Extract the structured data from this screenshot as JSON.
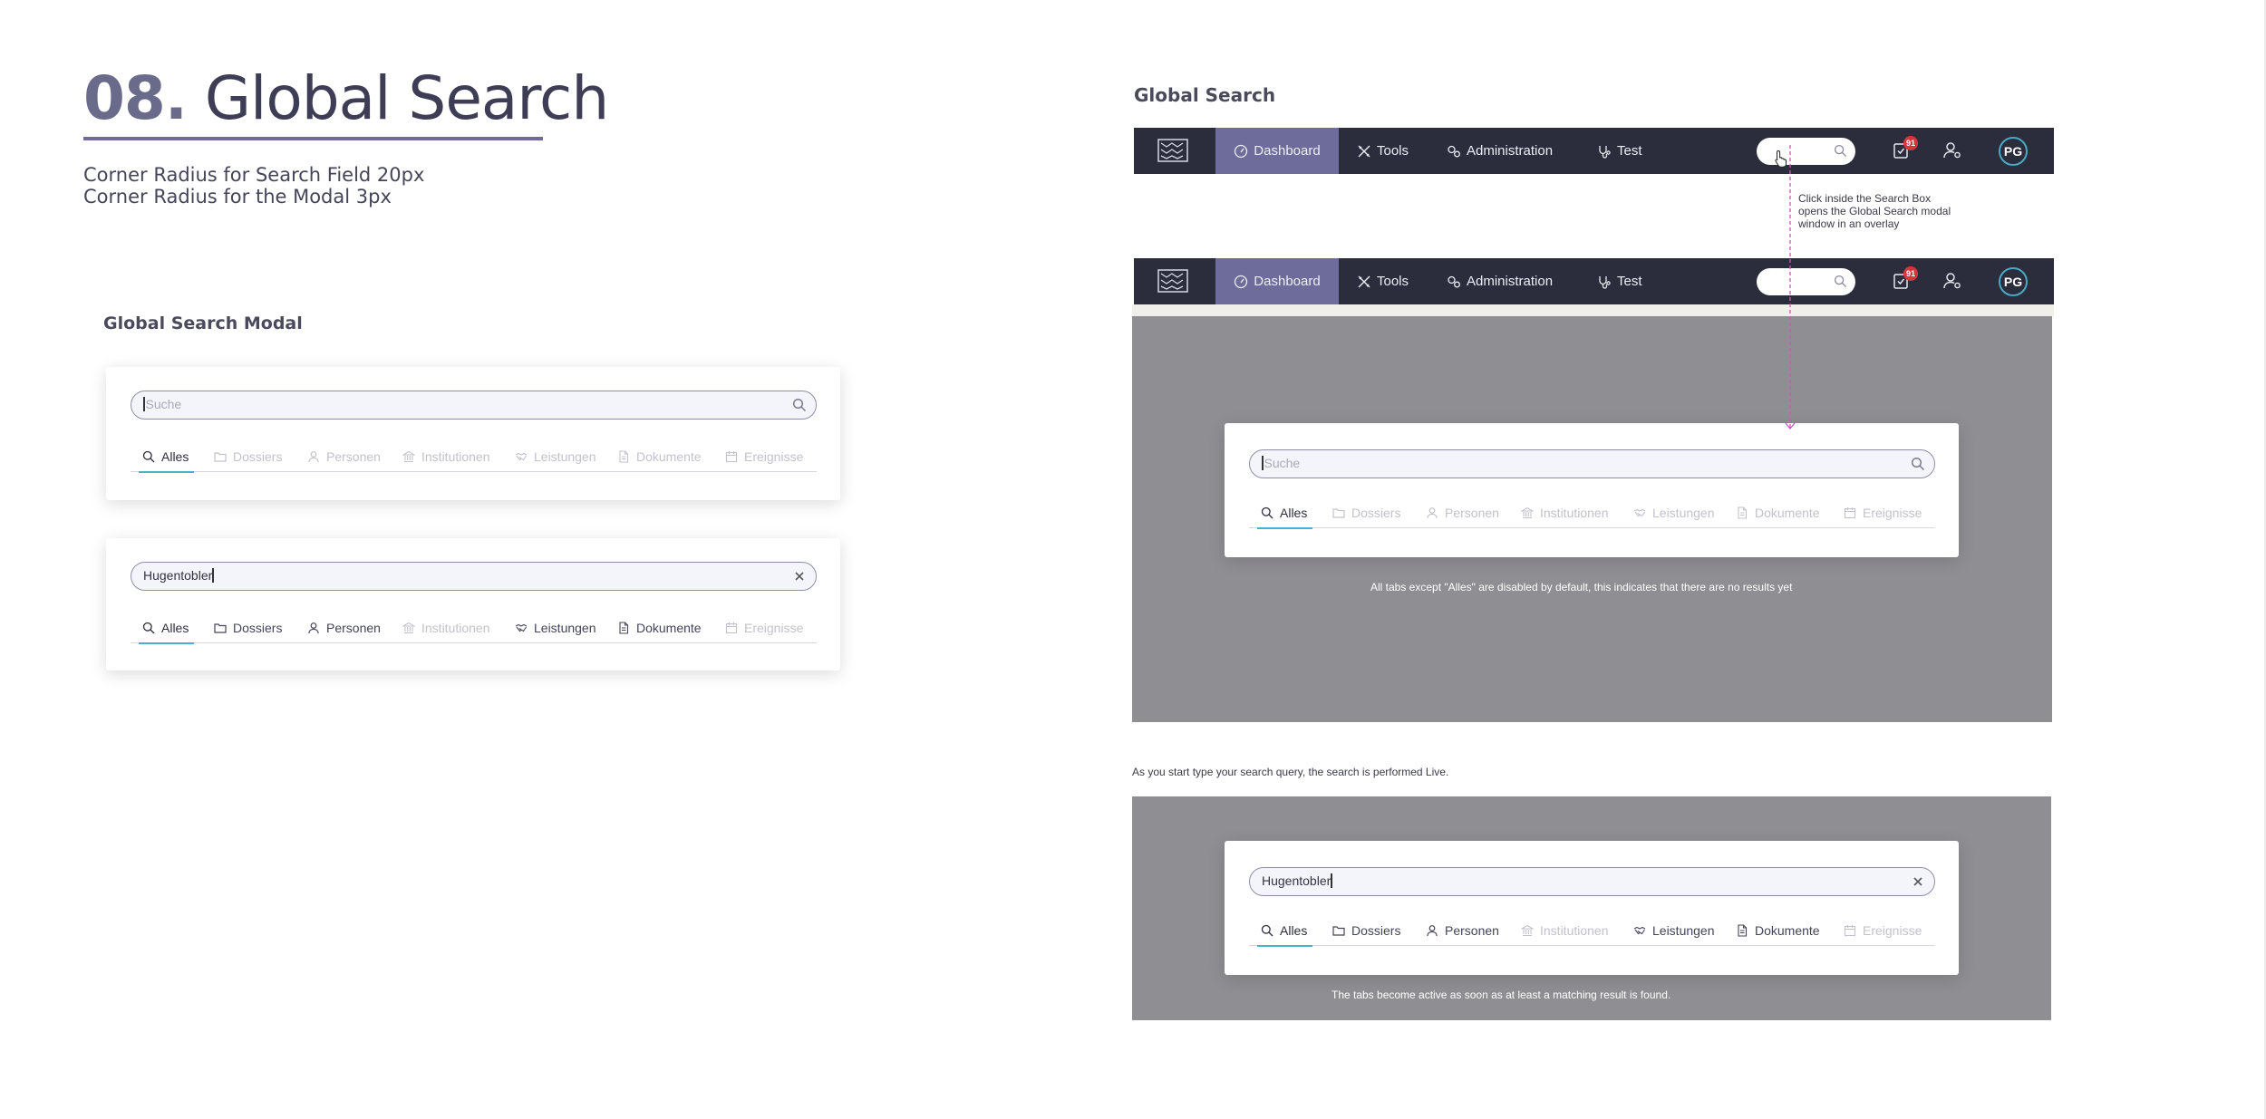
{
  "heading": {
    "number": "08.",
    "title": "Global Search"
  },
  "notes": [
    "Corner Radius for Search Field 20px",
    "Corner Radius for the Modal 3px"
  ],
  "left_section_label": "Global Search Modal",
  "right_section_label": "Global Search",
  "tabs": [
    {
      "label": "Alles",
      "icon": "search-icon"
    },
    {
      "label": "Dossiers",
      "icon": "folder-icon"
    },
    {
      "label": "Personen",
      "icon": "person-icon"
    },
    {
      "label": "Institutionen",
      "icon": "institution-icon"
    },
    {
      "label": "Leistungen",
      "icon": "handshake-icon"
    },
    {
      "label": "Dokumente",
      "icon": "document-icon"
    },
    {
      "label": "Ereignisse",
      "icon": "calendar-icon"
    }
  ],
  "empty_search": {
    "placeholder": "Suche",
    "enabled_tabs": [
      "Alles"
    ]
  },
  "filled_search": {
    "value": "Hugentobler",
    "enabled_tabs": [
      "Alles",
      "Dossiers",
      "Personen",
      "Leistungen",
      "Dokumente"
    ],
    "disabled_tabs": [
      "Institutionen",
      "Ereignisse"
    ]
  },
  "navbar": {
    "items": [
      "Dashboard",
      "Tools",
      "Administration",
      "Test"
    ],
    "active": "Dashboard",
    "notification_count": "91",
    "avatar_initials": "PG"
  },
  "annotations": {
    "click_hint": "Click inside the Search Box opens the Global Search modal window in an overlay",
    "disabled_hint": "All tabs except \"Alles\" are disabled by default, this indicates that there are no results yet",
    "live_hint": "As you start type your search query, the search is performed Live.",
    "active_hint": "The tabs become active as soon as at least a matching result is found."
  },
  "colors": {
    "navbar_bg": "#2b2d3c",
    "nav_active": "#6d6c9a",
    "accent": "#46b3cc",
    "overlay": "#8f8e93",
    "badge": "#d9343c",
    "annotation_line": "#d94fd0"
  }
}
